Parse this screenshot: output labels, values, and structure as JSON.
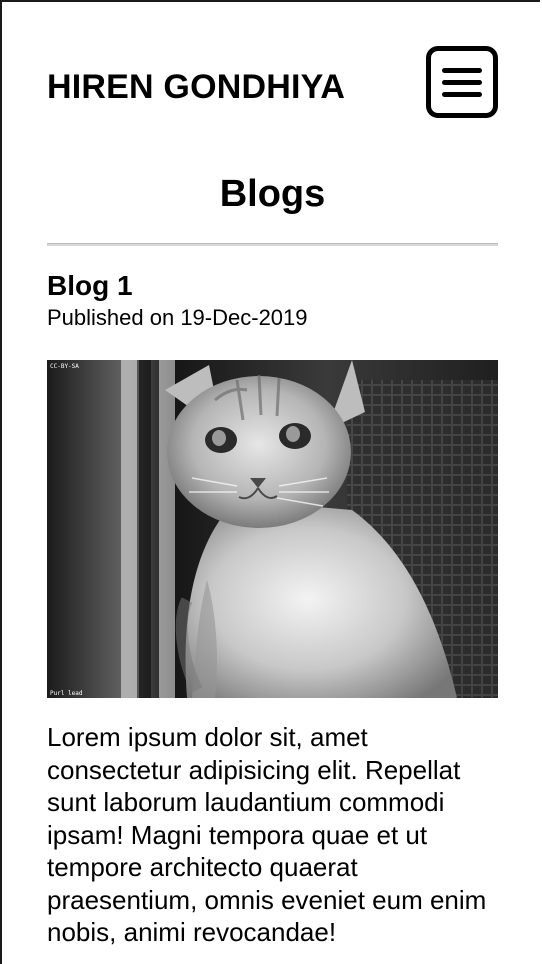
{
  "header": {
    "site_title": "HIREN GONDHIYA",
    "menu_icon": "hamburger-menu-icon"
  },
  "page": {
    "heading": "Blogs"
  },
  "post": {
    "title": "Blog 1",
    "published": "Published on 19-Dec-2019",
    "image_overlay_top": "CC-BY-SA",
    "image_overlay_bottom": "Purl lead",
    "body": "Lorem ipsum dolor sit, amet consectetur adipisicing elit. Repellat sunt laborum laudantium commodi ipsam! Magni tempora quae et ut tempore architecto quaerat praesentium, omnis eveniet eum enim nobis, animi revocandae!"
  },
  "colors": {
    "text": "#000000",
    "background": "#ffffff",
    "divider": "#d6d6d6"
  }
}
